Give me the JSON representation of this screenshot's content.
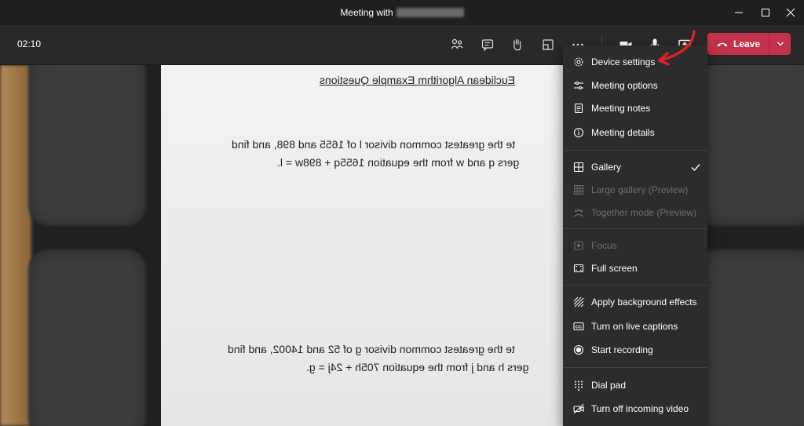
{
  "window": {
    "title": "Meeting with"
  },
  "toolbar": {
    "timer": "02:10",
    "leave_label": "Leave"
  },
  "paper": {
    "heading": "Euclidean Algorithm Example Questions",
    "q1_line1": "te the greatest common divisor l of 1655 and 898, and find",
    "q1_line2": "gers q and w from the equation 1655q + 898w = l.",
    "q2_line1": "te the greatest common divisor g of 52 and 14002, and find",
    "q2_line2": "gers h and j from the equation 705h + 24j = g."
  },
  "menu": {
    "items": [
      {
        "label": "Device settings",
        "icon": "gear-icon",
        "enabled": true
      },
      {
        "label": "Meeting options",
        "icon": "sliders-icon",
        "enabled": true
      },
      {
        "label": "Meeting notes",
        "icon": "notes-icon",
        "enabled": true
      },
      {
        "label": "Meeting details",
        "icon": "info-icon",
        "enabled": true
      },
      {
        "label": "Gallery",
        "icon": "gallery-icon",
        "enabled": true,
        "checked": true
      },
      {
        "label": "Large gallery (Preview)",
        "icon": "large-gallery-icon",
        "enabled": false
      },
      {
        "label": "Together mode (Preview)",
        "icon": "together-mode-icon",
        "enabled": false
      },
      {
        "label": "Focus",
        "icon": "focus-icon",
        "enabled": false
      },
      {
        "label": "Full screen",
        "icon": "fullscreen-icon",
        "enabled": true
      },
      {
        "label": "Apply background effects",
        "icon": "background-effects-icon",
        "enabled": true
      },
      {
        "label": "Turn on live captions",
        "icon": "captions-icon",
        "enabled": true
      },
      {
        "label": "Start recording",
        "icon": "record-icon",
        "enabled": true
      },
      {
        "label": "Dial pad",
        "icon": "dialpad-icon",
        "enabled": true
      },
      {
        "label": "Turn off incoming video",
        "icon": "video-off-icon",
        "enabled": true
      }
    ]
  },
  "colors": {
    "leave_button": "#c4314b",
    "menu_background": "#2d2c2c",
    "annotation_arrow": "#e02020"
  }
}
